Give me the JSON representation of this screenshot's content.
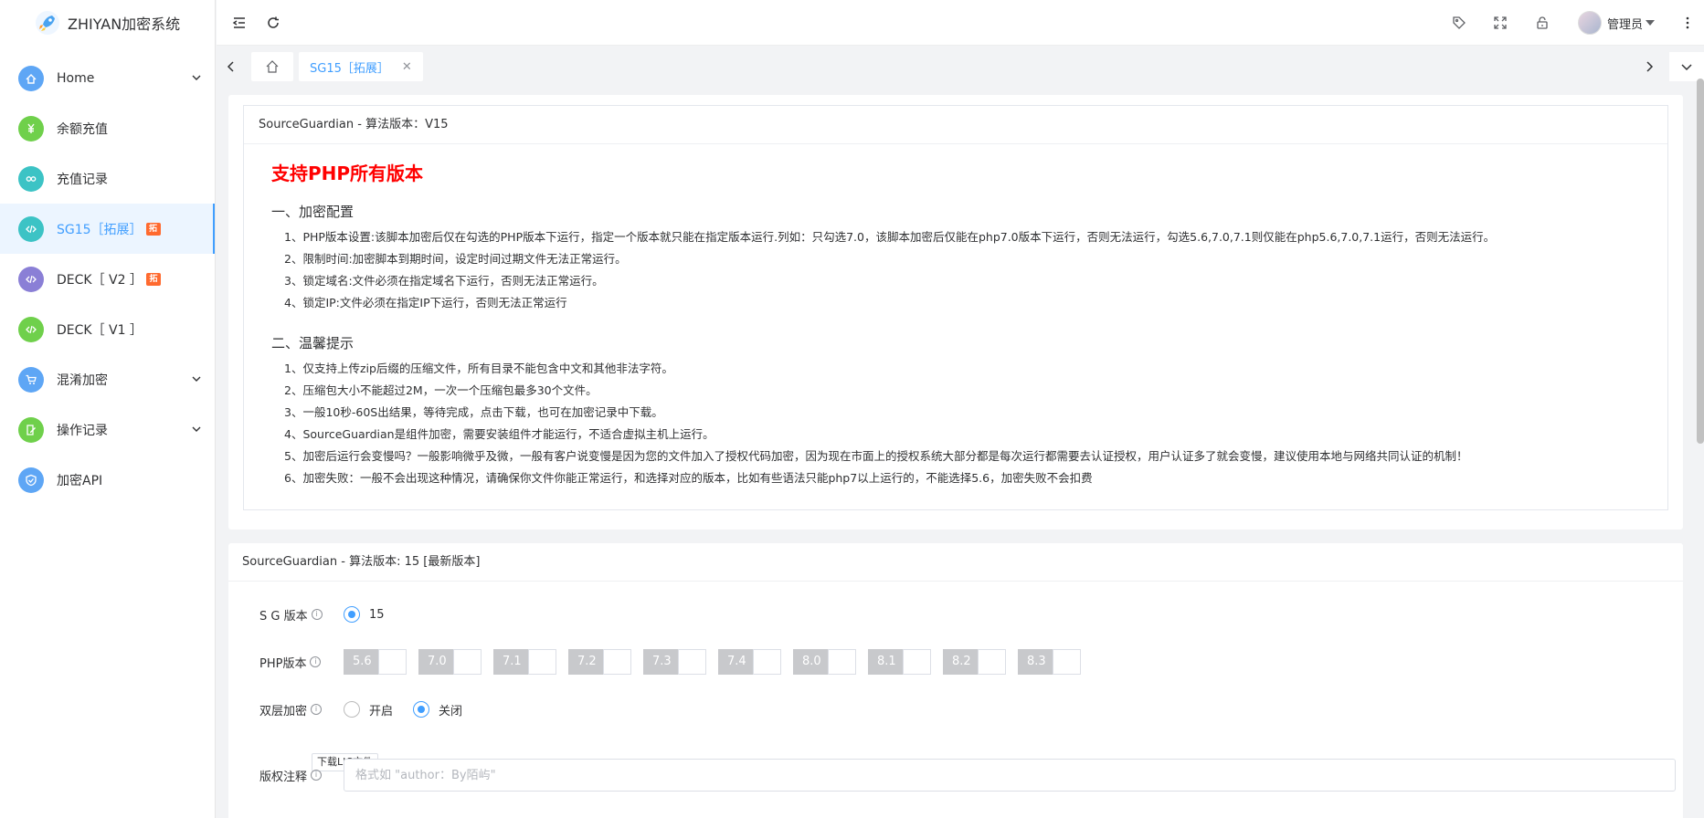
{
  "app": {
    "title": "ZHIYAN加密系统"
  },
  "sidebar": {
    "items": [
      {
        "label": "Home",
        "icon": "home-icon",
        "color": "#5ea6f5",
        "hasArrow": true
      },
      {
        "label": "余额充值",
        "icon": "yen-icon",
        "color": "#6fd04b",
        "hasArrow": false
      },
      {
        "label": "充值记录",
        "icon": "record-icon",
        "color": "#3cc3c5",
        "hasArrow": false
      },
      {
        "label": "SG15［拓展］",
        "icon": "code-icon",
        "color": "#3cc3c5",
        "hasArrow": false,
        "badge": "拓"
      },
      {
        "label": "DECK［ V2 ］",
        "icon": "code-icon",
        "color": "#8a7fd6",
        "hasArrow": false,
        "badge": "拓"
      },
      {
        "label": "DECK［ V1 ］",
        "icon": "code-icon",
        "color": "#6fd04b",
        "hasArrow": false
      },
      {
        "label": "混淆加密",
        "icon": "cart-icon",
        "color": "#5ea6f5",
        "hasArrow": true
      },
      {
        "label": "操作记录",
        "icon": "edit-icon",
        "color": "#6fd04b",
        "hasArrow": true
      },
      {
        "label": "加密API",
        "icon": "shield-icon",
        "color": "#5ea6f5",
        "hasArrow": false
      }
    ],
    "activeIndex": 3
  },
  "header": {
    "username": "管理员"
  },
  "tags": {
    "activeTab": "SG15［拓展］"
  },
  "panel1": {
    "title": "SourceGuardian - 算法版本：V15",
    "headline": "支持PHP所有版本",
    "section1_title": "一、加密配置",
    "section1_lines": [
      "1、PHP版本设置:该脚本加密后仅在勾选的PHP版本下运行，指定一个版本就只能在指定版本运行.列如：只勾选7.0，该脚本加密后仅能在php7.0版本下运行，否则无法运行，勾选5.6,7.0,7.1则仅能在php5.6,7.0,7.1运行，否则无法运行。",
      "2、限制时间:加密脚本到期时间，设定时间过期文件无法正常运行。",
      "3、锁定域名:文件必须在指定域名下运行，否则无法正常运行。",
      "4、锁定IP:文件必须在指定IP下运行，否则无法正常运行"
    ],
    "section2_title": "二、温馨提示",
    "section2_lines": [
      "1、仅支持上传zip后缀的压缩文件，所有目录不能包含中文和其他非法字符。",
      "2、压缩包大小不能超过2M，一次一个压缩包最多30个文件。",
      "3、一般10秒-60S出结果，等待完成，点击下载，也可在加密记录中下载。",
      "4、SourceGuardian是组件加密，需要安装组件才能运行，不适合虚拟主机上运行。",
      "5、加密后运行会变慢吗？一般影响微乎及微，一般有客户说变慢是因为您的文件加入了授权代码加密，因为现在市面上的授权系统大部分都是每次运行都需要去认证授权，用户认证多了就会变慢，建议使用本地与网络共同认证的机制！",
      "6、加密失败：一般不会出现这种情况，请确保你文件你能正常运行，和选择对应的版本，比如有些语法只能php7以上运行的，不能选择5.6，加密失败不会扣费"
    ]
  },
  "panel2": {
    "title": "SourceGuardian - 算法版本: 15 [最新版本]",
    "sg_label": "S G 版本",
    "sg_value": "15",
    "php_label": "PHP版本",
    "php_versions": [
      "5.6",
      "7.0",
      "7.1",
      "7.2",
      "7.3",
      "7.4",
      "8.0",
      "8.1",
      "8.2",
      "8.3"
    ],
    "double_label": "双层加密",
    "double_on": "开启",
    "double_off": "关闭",
    "lic_button": "下载LIC文件",
    "copyright_label": "版权注释",
    "copyright_placeholder": "格式如 \"author：By陌屿\""
  }
}
